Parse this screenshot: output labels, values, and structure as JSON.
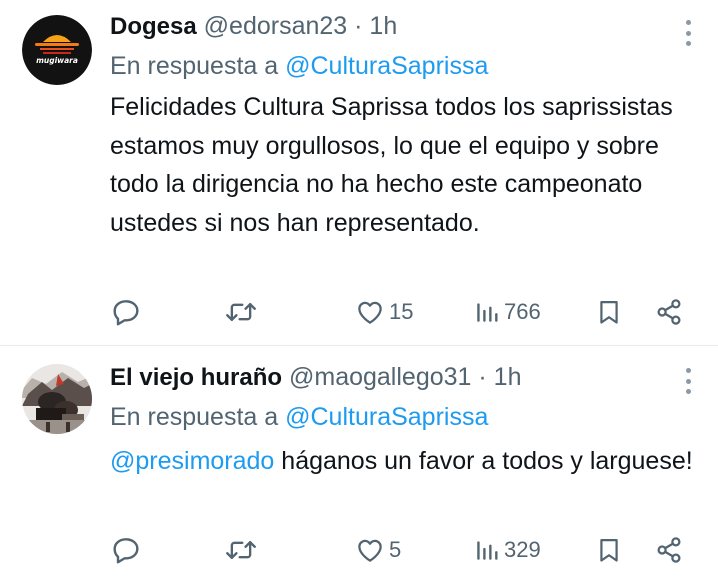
{
  "tweets": [
    {
      "author": {
        "display_name": "Dogesa",
        "handle": "@edorsan23",
        "separator": "·",
        "time": "1h",
        "avatar_text": "mugiwara"
      },
      "reply_prefix": "En respuesta a",
      "reply_handle": "@CulturaSaprissa",
      "text": "Felicidades Cultura Saprissa todos los saprissistas estamos muy orgullosos, lo que el equipo y sobre todo la dirigencia no ha hecho este campeonato ustedes si nos han representado.",
      "likes": "15",
      "views": "766"
    },
    {
      "author": {
        "display_name": "El viejo huraño",
        "handle": "@maogallego31",
        "separator": "·",
        "time": "1h"
      },
      "reply_prefix": "En respuesta a",
      "reply_handle": "@CulturaSaprissa",
      "mention": "@presimorado",
      "text": " háganos un favor a todos y larguese!",
      "likes": "5",
      "views": "329"
    }
  ],
  "colors": {
    "text": "#0f1419",
    "secondary": "#536471",
    "link": "#1d9bf0",
    "divider": "#e6ecf0"
  },
  "icons": [
    "reply-icon",
    "retweet-icon",
    "like-icon",
    "views-icon",
    "bookmark-icon",
    "share-icon",
    "more-icon"
  ]
}
